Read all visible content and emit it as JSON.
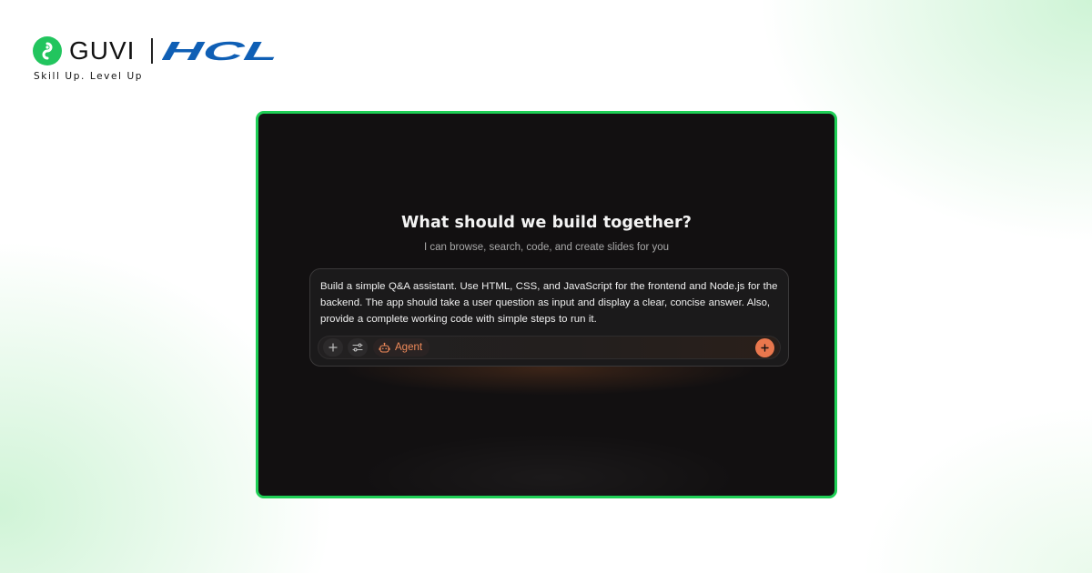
{
  "brand": {
    "guvi_name": "GUVI",
    "partner_name": "HCL",
    "tagline": "Skill Up. Level Up",
    "guvi_color": "#22c55e",
    "hcl_color": "#0f5fb5"
  },
  "app": {
    "frame_border_color": "#1fcf56",
    "background_color": "#121011",
    "title": "What should we build together?",
    "subtitle": "I can browse, search, code, and create slides for you",
    "composer": {
      "prompt": "Build a simple Q&A assistant. Use HTML, CSS, and JavaScript for the frontend and Node.js for the backend. The app should take a user question as input and display a clear, concise answer. Also, provide a complete working code with simple steps to run it.",
      "toolbar": {
        "add_icon": "plus-icon",
        "settings_icon": "sliders-icon",
        "agent_icon": "robot-icon",
        "agent_label": "Agent",
        "send_icon": "plus-icon",
        "accent_color": "#e9774d"
      }
    }
  }
}
